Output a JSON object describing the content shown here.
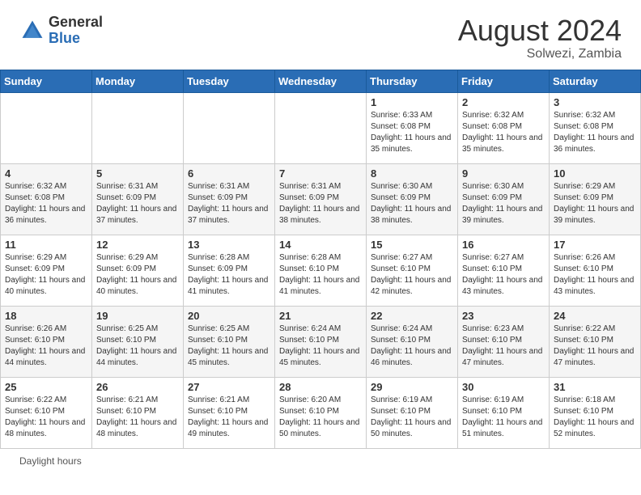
{
  "header": {
    "logo_general": "General",
    "logo_blue": "Blue",
    "month_year": "August 2024",
    "location": "Solwezi, Zambia"
  },
  "days_of_week": [
    "Sunday",
    "Monday",
    "Tuesday",
    "Wednesday",
    "Thursday",
    "Friday",
    "Saturday"
  ],
  "weeks": [
    [
      {
        "day": "",
        "info": ""
      },
      {
        "day": "",
        "info": ""
      },
      {
        "day": "",
        "info": ""
      },
      {
        "day": "",
        "info": ""
      },
      {
        "day": "1",
        "info": "Sunrise: 6:33 AM\nSunset: 6:08 PM\nDaylight: 11 hours and 35 minutes."
      },
      {
        "day": "2",
        "info": "Sunrise: 6:32 AM\nSunset: 6:08 PM\nDaylight: 11 hours and 35 minutes."
      },
      {
        "day": "3",
        "info": "Sunrise: 6:32 AM\nSunset: 6:08 PM\nDaylight: 11 hours and 36 minutes."
      }
    ],
    [
      {
        "day": "4",
        "info": "Sunrise: 6:32 AM\nSunset: 6:08 PM\nDaylight: 11 hours and 36 minutes."
      },
      {
        "day": "5",
        "info": "Sunrise: 6:31 AM\nSunset: 6:09 PM\nDaylight: 11 hours and 37 minutes."
      },
      {
        "day": "6",
        "info": "Sunrise: 6:31 AM\nSunset: 6:09 PM\nDaylight: 11 hours and 37 minutes."
      },
      {
        "day": "7",
        "info": "Sunrise: 6:31 AM\nSunset: 6:09 PM\nDaylight: 11 hours and 38 minutes."
      },
      {
        "day": "8",
        "info": "Sunrise: 6:30 AM\nSunset: 6:09 PM\nDaylight: 11 hours and 38 minutes."
      },
      {
        "day": "9",
        "info": "Sunrise: 6:30 AM\nSunset: 6:09 PM\nDaylight: 11 hours and 39 minutes."
      },
      {
        "day": "10",
        "info": "Sunrise: 6:29 AM\nSunset: 6:09 PM\nDaylight: 11 hours and 39 minutes."
      }
    ],
    [
      {
        "day": "11",
        "info": "Sunrise: 6:29 AM\nSunset: 6:09 PM\nDaylight: 11 hours and 40 minutes."
      },
      {
        "day": "12",
        "info": "Sunrise: 6:29 AM\nSunset: 6:09 PM\nDaylight: 11 hours and 40 minutes."
      },
      {
        "day": "13",
        "info": "Sunrise: 6:28 AM\nSunset: 6:09 PM\nDaylight: 11 hours and 41 minutes."
      },
      {
        "day": "14",
        "info": "Sunrise: 6:28 AM\nSunset: 6:10 PM\nDaylight: 11 hours and 41 minutes."
      },
      {
        "day": "15",
        "info": "Sunrise: 6:27 AM\nSunset: 6:10 PM\nDaylight: 11 hours and 42 minutes."
      },
      {
        "day": "16",
        "info": "Sunrise: 6:27 AM\nSunset: 6:10 PM\nDaylight: 11 hours and 43 minutes."
      },
      {
        "day": "17",
        "info": "Sunrise: 6:26 AM\nSunset: 6:10 PM\nDaylight: 11 hours and 43 minutes."
      }
    ],
    [
      {
        "day": "18",
        "info": "Sunrise: 6:26 AM\nSunset: 6:10 PM\nDaylight: 11 hours and 44 minutes."
      },
      {
        "day": "19",
        "info": "Sunrise: 6:25 AM\nSunset: 6:10 PM\nDaylight: 11 hours and 44 minutes."
      },
      {
        "day": "20",
        "info": "Sunrise: 6:25 AM\nSunset: 6:10 PM\nDaylight: 11 hours and 45 minutes."
      },
      {
        "day": "21",
        "info": "Sunrise: 6:24 AM\nSunset: 6:10 PM\nDaylight: 11 hours and 45 minutes."
      },
      {
        "day": "22",
        "info": "Sunrise: 6:24 AM\nSunset: 6:10 PM\nDaylight: 11 hours and 46 minutes."
      },
      {
        "day": "23",
        "info": "Sunrise: 6:23 AM\nSunset: 6:10 PM\nDaylight: 11 hours and 47 minutes."
      },
      {
        "day": "24",
        "info": "Sunrise: 6:22 AM\nSunset: 6:10 PM\nDaylight: 11 hours and 47 minutes."
      }
    ],
    [
      {
        "day": "25",
        "info": "Sunrise: 6:22 AM\nSunset: 6:10 PM\nDaylight: 11 hours and 48 minutes."
      },
      {
        "day": "26",
        "info": "Sunrise: 6:21 AM\nSunset: 6:10 PM\nDaylight: 11 hours and 48 minutes."
      },
      {
        "day": "27",
        "info": "Sunrise: 6:21 AM\nSunset: 6:10 PM\nDaylight: 11 hours and 49 minutes."
      },
      {
        "day": "28",
        "info": "Sunrise: 6:20 AM\nSunset: 6:10 PM\nDaylight: 11 hours and 50 minutes."
      },
      {
        "day": "29",
        "info": "Sunrise: 6:19 AM\nSunset: 6:10 PM\nDaylight: 11 hours and 50 minutes."
      },
      {
        "day": "30",
        "info": "Sunrise: 6:19 AM\nSunset: 6:10 PM\nDaylight: 11 hours and 51 minutes."
      },
      {
        "day": "31",
        "info": "Sunrise: 6:18 AM\nSunset: 6:10 PM\nDaylight: 11 hours and 52 minutes."
      }
    ]
  ],
  "footer": {
    "daylight_hours_label": "Daylight hours"
  }
}
